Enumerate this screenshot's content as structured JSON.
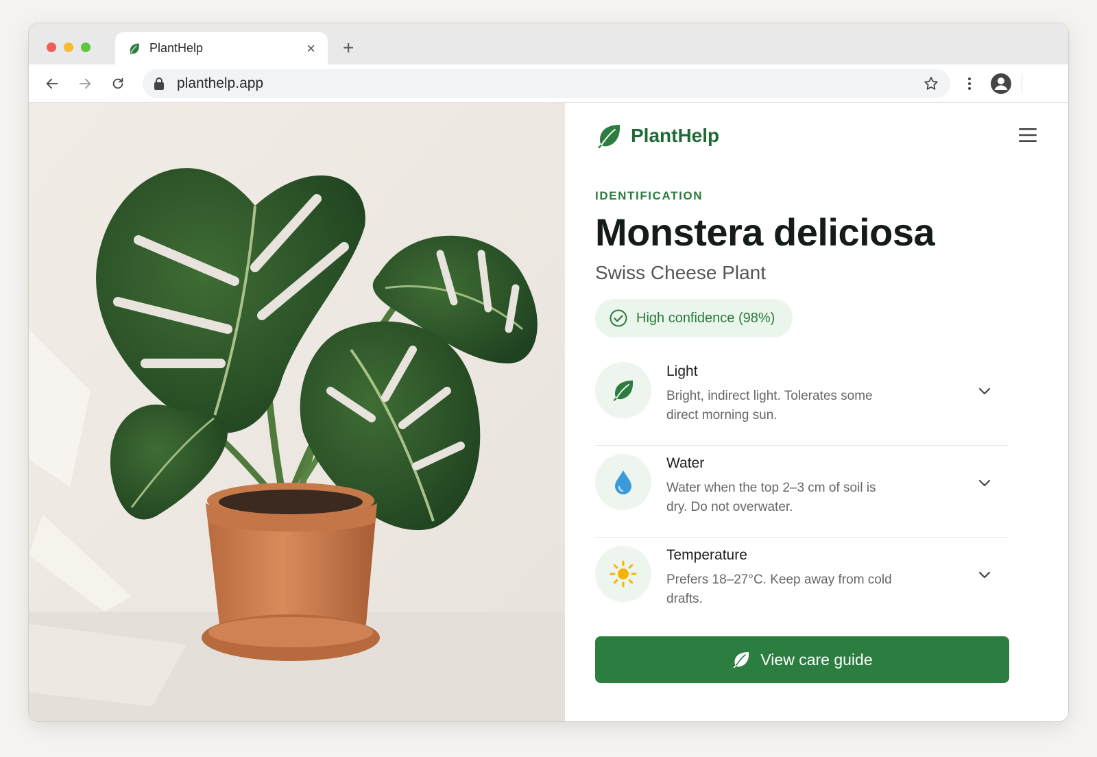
{
  "browser": {
    "tab_title": "PlantHelp",
    "url": "planthelp.app",
    "icons": {
      "tab": "leaf-icon",
      "close": "close-icon",
      "new_tab": "plus-icon",
      "back": "arrow-left-icon",
      "forward": "arrow-right-icon",
      "reload": "reload-icon",
      "lock": "lock-icon",
      "bookmark": "star-icon",
      "menu": "kebab-icon",
      "profile": "profile-icon"
    }
  },
  "app": {
    "brand": "PlantHelp",
    "brand_color": "#1f6b34",
    "accent": "#2b7d40",
    "menu_icon": "hamburger-icon"
  },
  "identification": {
    "eyebrow": "IDENTIFICATION",
    "species": "Monstera deliciosa",
    "common_name": "Swiss Cheese Plant",
    "confidence_label": "High confidence (98%)",
    "confidence_value": 0.98
  },
  "care": [
    {
      "title": "Light",
      "description": "Bright, indirect light. Tolerates some direct morning sun.",
      "icon": "leaf-icon"
    },
    {
      "title": "Water",
      "description": "Water when the top 2–3 cm of soil is dry. Do not overwater.",
      "icon": "water-drop-icon"
    },
    {
      "title": "Temperature",
      "description": "Prefers 18–27°C. Keep away from cold drafts.",
      "icon": "sun-icon"
    }
  ],
  "cta": {
    "label": "View care guide",
    "icon": "leaf-icon"
  }
}
